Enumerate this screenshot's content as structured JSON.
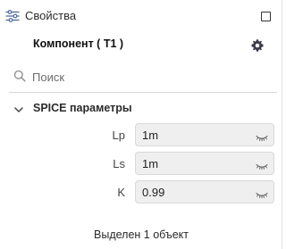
{
  "window": {
    "title": "Свойства",
    "title_icon": "sliders-icon",
    "maximize_icon": "square-icon"
  },
  "component": {
    "title": "Компонент ( T1 )",
    "settings_icon": "gear-icon"
  },
  "search": {
    "placeholder": "Поиск",
    "value": "",
    "icon": "search-icon"
  },
  "section": {
    "title": "SPICE параметры",
    "expanded": true,
    "icon": "chevron-down-icon"
  },
  "parameters": [
    {
      "label": "Lp",
      "value": "1m",
      "visibility_icon": "eye-closed-icon"
    },
    {
      "label": "Ls",
      "value": "1m",
      "visibility_icon": "eye-closed-icon"
    },
    {
      "label": "K",
      "value": "0.99",
      "visibility_icon": "eye-closed-icon"
    }
  ],
  "status": {
    "text": "Выделен 1 объект"
  },
  "colors": {
    "background": "#ffffff",
    "field_background": "#efefef",
    "field_border": "#d8d8d8",
    "icon": "#555555",
    "settings_icon": "#3a3a4a"
  }
}
